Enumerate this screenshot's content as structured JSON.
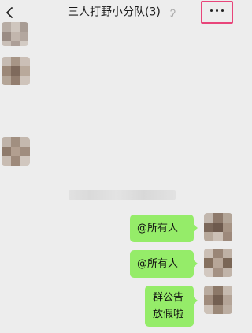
{
  "header": {
    "title": "三人打野小分队(3)",
    "back_icon": "chevron-left-icon",
    "mute_icon": "ear-icon",
    "more_icon": "more-dots-icon",
    "highlight_color": "#e8457a"
  },
  "messages": {
    "incoming": [
      {
        "avatar": "pixelated-avatar"
      },
      {
        "avatar": "pixelated-avatar"
      },
      {
        "avatar": "pixelated-avatar"
      }
    ],
    "outgoing": [
      {
        "lines": [
          "@所有人"
        ]
      },
      {
        "lines": [
          "@所有人"
        ]
      },
      {
        "lines": [
          "群公告",
          "放假啦"
        ]
      }
    ]
  },
  "colors": {
    "background": "#ededed",
    "bubble_outgoing": "#95ec69"
  }
}
